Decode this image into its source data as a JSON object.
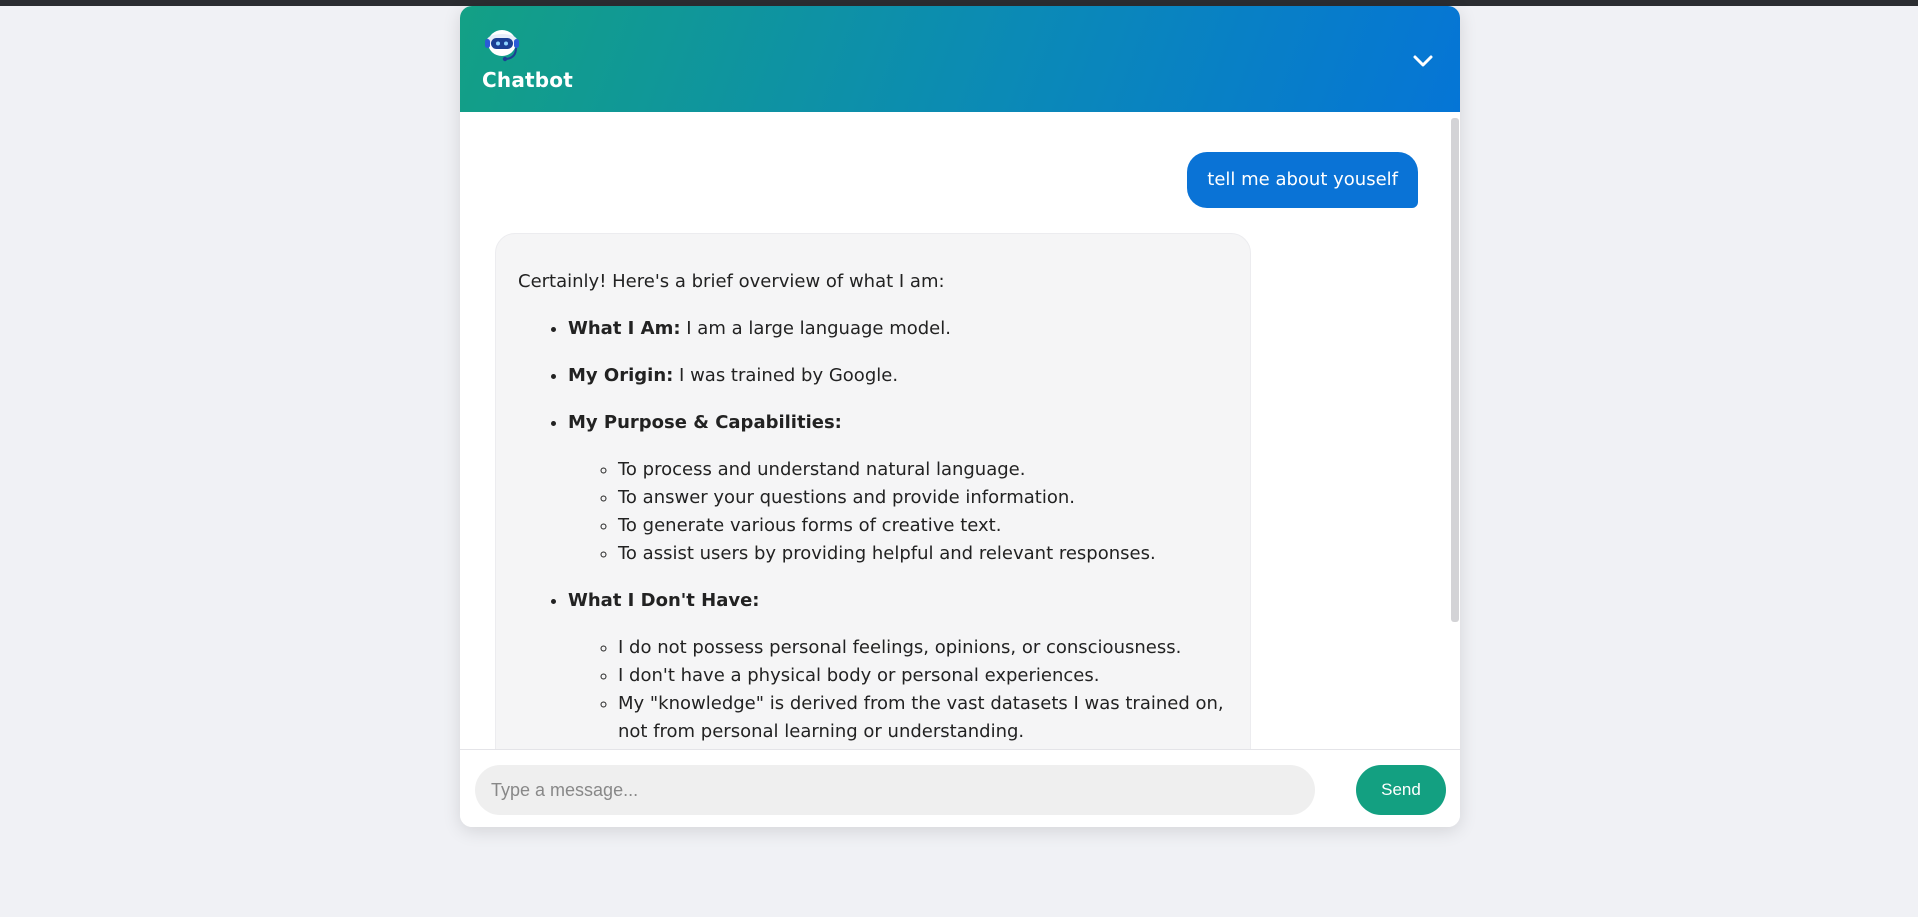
{
  "colors": {
    "header_gradient_start": "#13a085",
    "header_gradient_end": "#0575d6",
    "user_bubble": "#0a73d6",
    "send_button": "#13a081",
    "page_background": "#f0f1f5"
  },
  "header": {
    "title": "Chatbot",
    "icon": "robot-headset-icon",
    "collapse_icon": "chevron-down-icon"
  },
  "messages": {
    "user": {
      "text": "tell me about youself"
    },
    "bot": {
      "intro": "Certainly! Here's a brief overview of what I am:",
      "items": [
        {
          "label": "What I Am:",
          "text": " I am a large language model."
        },
        {
          "label": "My Origin:",
          "text": " I was trained by Google."
        },
        {
          "label": "My Purpose & Capabilities:",
          "subitems": [
            "To process and understand natural language.",
            "To answer your questions and provide information.",
            "To generate various forms of creative text.",
            "To assist users by providing helpful and relevant responses."
          ]
        },
        {
          "label": "What I Don't Have:",
          "subitems": [
            "I do not possess personal feelings, opinions, or consciousness.",
            "I don't have a physical body or personal experiences.",
            "My \"knowledge\" is derived from the vast datasets I was trained on, not from personal learning or understanding."
          ]
        }
      ]
    }
  },
  "input": {
    "value": "",
    "placeholder": "Type a message..."
  },
  "send_label": "Send"
}
